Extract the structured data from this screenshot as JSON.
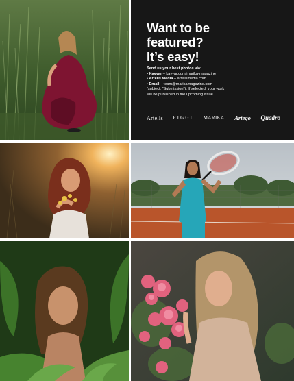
{
  "panel": {
    "headline": [
      "Want to be",
      "featured?",
      "It’s easy!"
    ],
    "intro": "Send us your best photos via:",
    "channels": [
      {
        "name": "Kavyar",
        "detail": " – kavyar.com/marika-magazine"
      },
      {
        "name": "Artells Media",
        "detail": " – artellsmedia.com"
      },
      {
        "name": "Email",
        "detail": " – team@marikamagazine.com"
      }
    ],
    "note_lines": [
      "(subject: “Submission”). If selected, your work",
      "will be published in the upcoming issue."
    ],
    "logos": [
      "Artells",
      "FIGGI",
      "MARIKA",
      "Artego",
      "Quadro"
    ]
  },
  "photos": [
    {
      "subject": "woman-in-burgundy-dress-crouching-in-tall-grass"
    },
    {
      "subject": "woman-with-flowers-at-sunset"
    },
    {
      "subject": "woman-with-tennis-racket-on-clay-court"
    },
    {
      "subject": "woman-among-green-leaves"
    },
    {
      "subject": "woman-holding-pink-roses"
    }
  ],
  "colors": {
    "panel_bg": "#171717",
    "panel_text": "#ffffff"
  }
}
